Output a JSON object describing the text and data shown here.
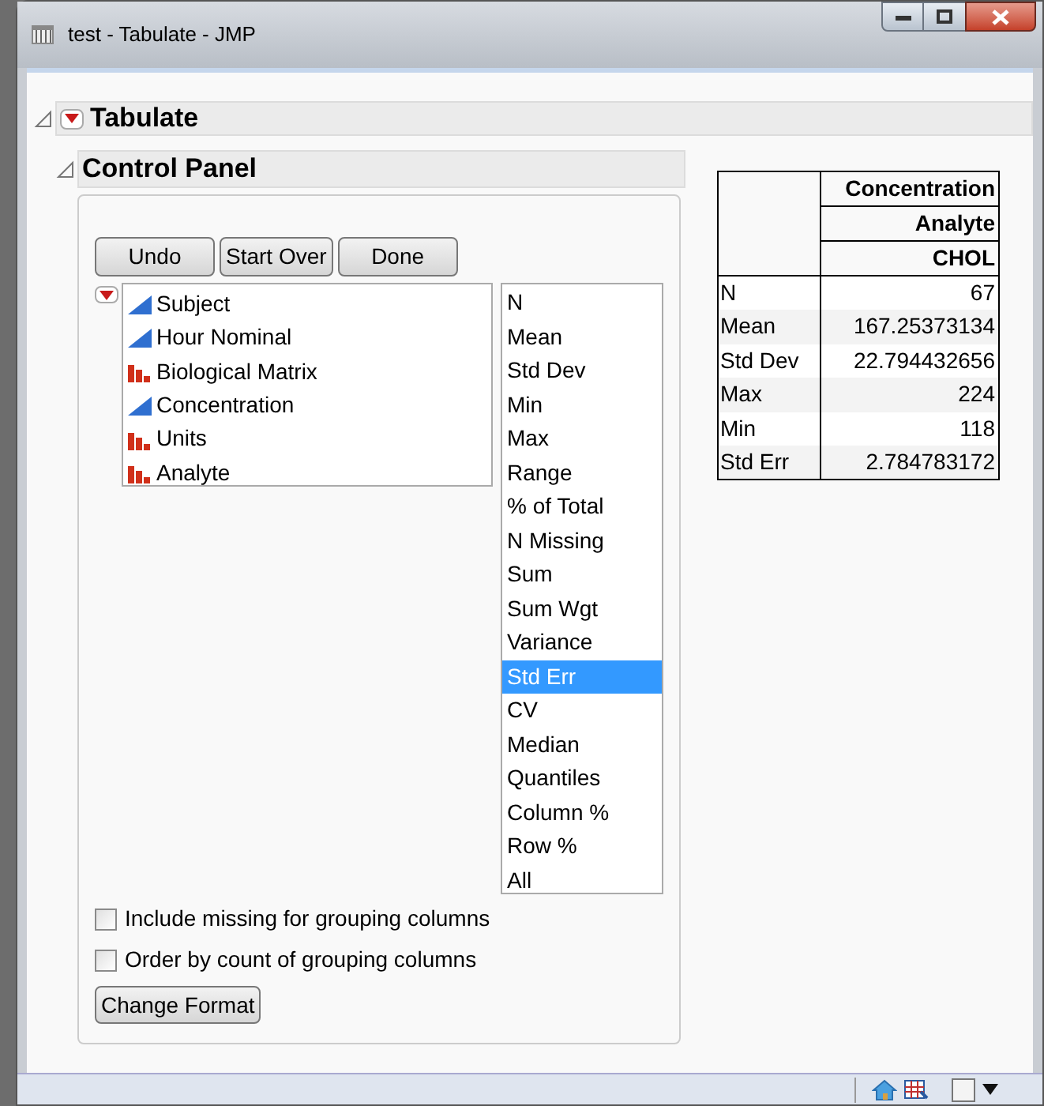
{
  "window": {
    "title": "test - Tabulate - JMP"
  },
  "report": {
    "title": "Tabulate",
    "expanded": true
  },
  "control_panel": {
    "title": "Control Panel",
    "expanded": true,
    "buttons": [
      "Undo",
      "Start Over",
      "Done"
    ],
    "columns": [
      {
        "label": "Subject",
        "kind": "continuous"
      },
      {
        "label": "Hour Nominal",
        "kind": "continuous"
      },
      {
        "label": "Biological Matrix",
        "kind": "nominal"
      },
      {
        "label": "Concentration",
        "kind": "continuous"
      },
      {
        "label": "Units",
        "kind": "nominal"
      },
      {
        "label": "Analyte",
        "kind": "nominal"
      }
    ],
    "statistics": [
      {
        "label": "N",
        "selected": false
      },
      {
        "label": "Mean",
        "selected": false
      },
      {
        "label": "Std Dev",
        "selected": false
      },
      {
        "label": "Min",
        "selected": false
      },
      {
        "label": "Max",
        "selected": false
      },
      {
        "label": "Range",
        "selected": false
      },
      {
        "label": "% of Total",
        "selected": false
      },
      {
        "label": "N Missing",
        "selected": false
      },
      {
        "label": "Sum",
        "selected": false
      },
      {
        "label": "Sum Wgt",
        "selected": false
      },
      {
        "label": "Variance",
        "selected": false
      },
      {
        "label": "Std Err",
        "selected": true
      },
      {
        "label": "CV",
        "selected": false
      },
      {
        "label": "Median",
        "selected": false
      },
      {
        "label": "Quantiles",
        "selected": false
      },
      {
        "label": "Column %",
        "selected": false
      },
      {
        "label": "Row %",
        "selected": false
      },
      {
        "label": "All",
        "selected": false
      }
    ],
    "options": [
      {
        "label": "Include missing for grouping columns",
        "checked": false
      },
      {
        "label": "Order by count of grouping columns",
        "checked": false
      }
    ],
    "format_button": "Change Format"
  },
  "table": {
    "headers": [
      "Concentration",
      "Analyte",
      "CHOL"
    ],
    "rows": [
      {
        "label": "N",
        "value": "67"
      },
      {
        "label": "Mean",
        "value": "167.25373134"
      },
      {
        "label": "Std Dev",
        "value": "22.794432656"
      },
      {
        "label": "Max",
        "value": "224"
      },
      {
        "label": "Min",
        "value": "118"
      },
      {
        "label": "Std Err",
        "value": "2.784783172"
      }
    ]
  }
}
